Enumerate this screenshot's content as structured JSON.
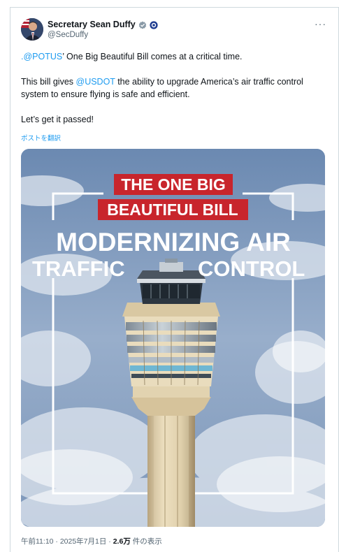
{
  "post": {
    "author_name": "Secretary Sean Duffy",
    "author_handle": "@SecDuffy",
    "more_label": "···",
    "line1_mention": ".@POTUS",
    "line1_rest": "’ One Big Beautiful Bill comes at a critical time.",
    "line2_pre": "This bill gives ",
    "line2_mention": "@USDOT",
    "line2_post": " the ability to upgrade America’s air traffic control system to ensure flying is safe and efficient.",
    "line3": "Let’s get it passed!",
    "translate_label": "ポストを翻訳",
    "timestamp": "午前11:10 · 2025年7月1日",
    "separator": " · ",
    "views_count": "2.6万",
    "views_label": " 件の表示"
  },
  "image": {
    "banner_line1": "THE ONE BIG",
    "banner_line2": "BEAUTIFUL BILL",
    "headline_line1": "MODERNIZING AIR",
    "headline_word1": "TRAFFIC",
    "headline_word2": "CONTROL"
  },
  "colors": {
    "banner_red": "#c8252c",
    "link_blue": "#1d9bf0",
    "verified_blue": "#1d9bf0"
  }
}
